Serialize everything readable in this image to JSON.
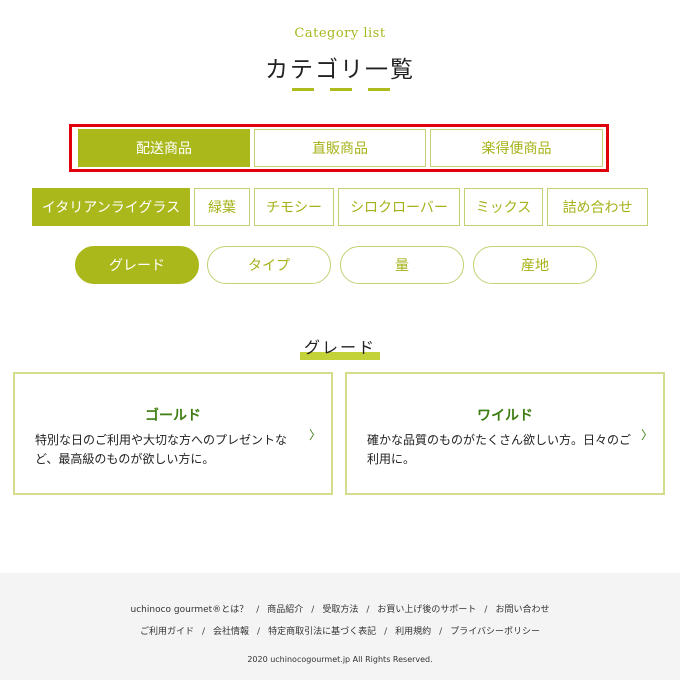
{
  "header": {
    "subtitle": "Category list",
    "title": "カテゴリ一覧"
  },
  "tabs": [
    {
      "label": "配送商品",
      "active": true
    },
    {
      "label": "直販商品",
      "active": false
    },
    {
      "label": "楽得便商品",
      "active": false
    }
  ],
  "products": [
    {
      "label": "イタリアンライグラス",
      "active": true
    },
    {
      "label": "緑葉",
      "active": false
    },
    {
      "label": "チモシー",
      "active": false
    },
    {
      "label": "シロクローバー",
      "active": false
    },
    {
      "label": "ミックス",
      "active": false
    },
    {
      "label": "詰め合わせ",
      "active": false
    }
  ],
  "filters": [
    {
      "label": "グレード",
      "active": true
    },
    {
      "label": "タイプ",
      "active": false
    },
    {
      "label": "量",
      "active": false
    },
    {
      "label": "産地",
      "active": false
    }
  ],
  "section": {
    "title": "グレード"
  },
  "cards": [
    {
      "title": "ゴールド",
      "description": "特別な日のご利用や大切な方へのプレゼントなど、最高級のものが欲しい方に。",
      "arrow": "〉"
    },
    {
      "title": "ワイルド",
      "description": "確かな品質のものがたくさん欲しい方。日々のご利用に。",
      "arrow": "〉"
    }
  ],
  "footer": {
    "row1": [
      "uchinoco gourmet®とは？",
      "商品紹介",
      "受取方法",
      "お買い上げ後のサポート",
      "お問い合わせ"
    ],
    "row2": [
      "ご利用ガイド",
      "会社情報",
      "特定商取引法に基づく表記",
      "利用規約",
      "プライバシーポリシー"
    ],
    "separator": "/",
    "copyright": "2020 uchinocogourmet.jp All Rights Reserved."
  },
  "colors": {
    "accent": "#aab81b",
    "accent_text": "#a6b219",
    "card_title": "#3d7d12",
    "highlight_box": "#e0000b"
  }
}
